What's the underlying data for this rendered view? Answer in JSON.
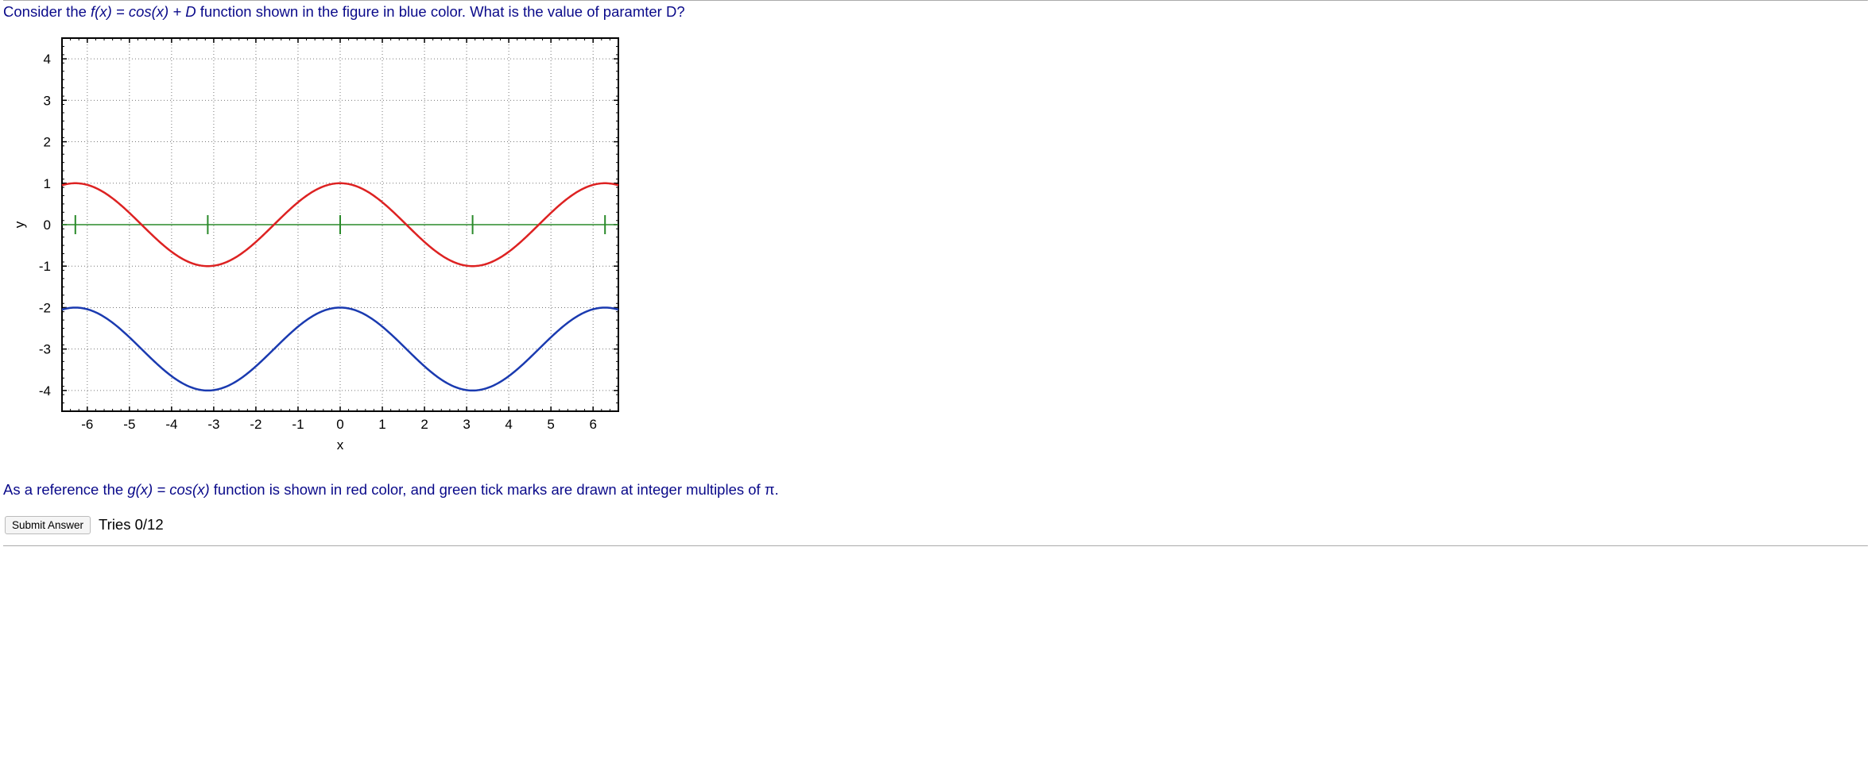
{
  "question": {
    "pre": "Consider the ",
    "f": "f(x) = cos(x) + D",
    "post": " function shown in the figure in blue color. What is the value of paramter D?"
  },
  "reference": {
    "pre": "As a reference the ",
    "g": "g(x) = cos(x)",
    "post": " function is shown in red color, and green tick marks are drawn at integer multiples of π."
  },
  "controls": {
    "submit_label": "Submit Answer",
    "tries": "Tries 0/12"
  },
  "chart_data": {
    "type": "line",
    "xlim": [
      -6.6,
      6.6
    ],
    "ylim": [
      -4.5,
      4.5
    ],
    "yticks": [
      -4,
      -3,
      -2,
      -1,
      0,
      1,
      2,
      3,
      4
    ],
    "xticks": [
      -6,
      -5,
      -4,
      -3,
      -2,
      -1,
      0,
      1,
      2,
      3,
      4,
      5,
      6
    ],
    "xlabel": "x",
    "ylabel": "y",
    "green_pi_ticks": [
      -2,
      -1,
      0,
      1,
      2
    ],
    "series": [
      {
        "name": "g(x) = cos(x)",
        "color": "#d22",
        "fn": "cos",
        "offset": 0
      },
      {
        "name": "f(x) = cos(x) + D",
        "color": "#1a3ab0",
        "fn": "cos",
        "offset": -3
      }
    ]
  }
}
